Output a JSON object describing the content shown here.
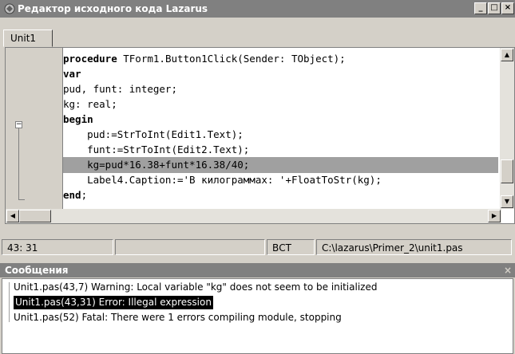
{
  "window": {
    "title": "Редактор исходного кода Lazarus",
    "buttons": [
      "_",
      "□",
      "×"
    ]
  },
  "tabs": [
    {
      "label": "Unit1",
      "active": true
    }
  ],
  "editor": {
    "lines": [
      {
        "kw": "procedure",
        "text": " TForm1.Button1Click(Sender: TObject);"
      },
      {
        "kw": "var",
        "text": ""
      },
      {
        "kw": "",
        "text": "pud, funt: integer;"
      },
      {
        "kw": "",
        "text": "kg: real;"
      },
      {
        "kw": "begin",
        "text": ""
      },
      {
        "kw": "",
        "text": "    pud:=StrToInt(Edit1.Text);"
      },
      {
        "kw": "",
        "text": "    funt:=StrToInt(Edit2.Text);"
      },
      {
        "kw": "",
        "text": "    kg=pud*16.38+funt*16.38/40;"
      },
      {
        "kw": "",
        "text": "    Label4.Caption:='В килограммах: '+FloatToStr(kg);"
      },
      {
        "kw": "end",
        "text": ";"
      }
    ],
    "highlighted_line": 8,
    "fold_marker": "−"
  },
  "statusbar": {
    "position": "43: 31",
    "insert_mode": "ВСТ",
    "file_path": "C:\\lazarus\\Primer_2\\unit1.pas"
  },
  "messages": {
    "title": "Сообщения",
    "items": [
      {
        "text": "Unit1.pas(43,7) Warning: Local variable \"kg\" does not seem to be initialized",
        "selected": false
      },
      {
        "text": "Unit1.pas(43,31) Error: Illegal expression",
        "selected": true
      },
      {
        "text": "Unit1.pas(52) Fatal: There were 1 errors compiling module, stopping",
        "selected": false
      }
    ]
  },
  "colors": {
    "titlebar": "#808080",
    "highlight": "#a0a0a0",
    "background": "#d4d0c8"
  }
}
